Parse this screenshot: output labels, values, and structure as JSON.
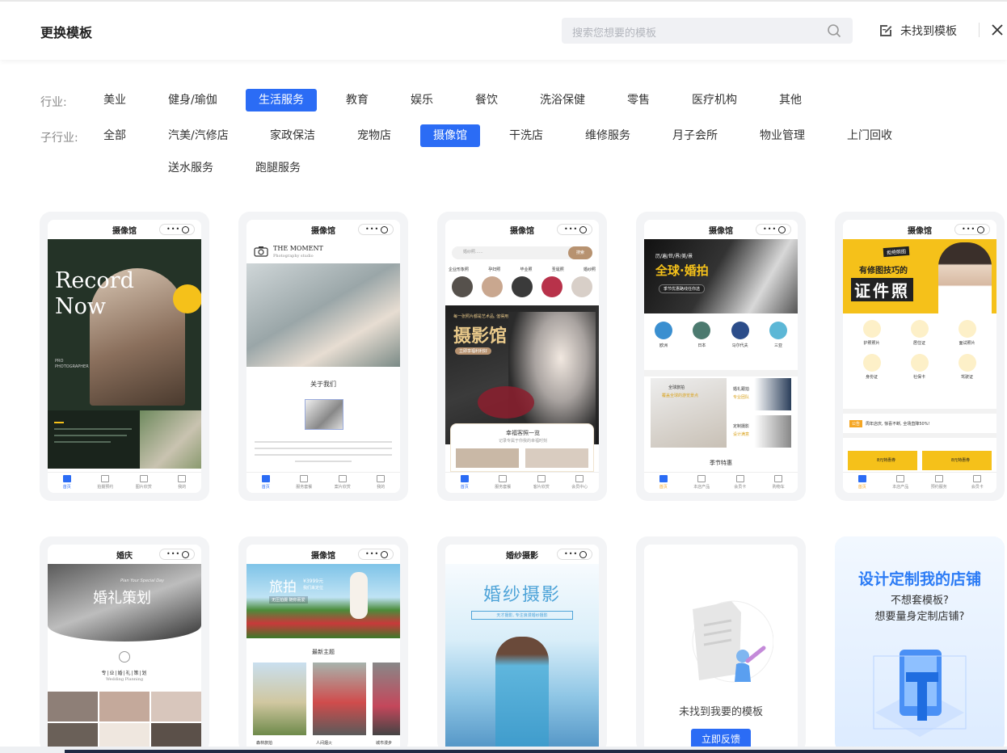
{
  "header": {
    "title": "更换模板",
    "search_placeholder": "搜索您想要的模板",
    "notfound_label": "未找到模板"
  },
  "filters": {
    "industry_label": "行业:",
    "industries": [
      "美业",
      "健身/瑜伽",
      "生活服务",
      "教育",
      "娱乐",
      "餐饮",
      "洗浴保健",
      "零售",
      "医疗机构",
      "其他"
    ],
    "industry_active": "生活服务",
    "subindustry_label": "子行业:",
    "subindustries": [
      "全部",
      "汽美/汽修店",
      "家政保洁",
      "宠物店",
      "摄像馆",
      "干洗店",
      "维修服务",
      "月子会所",
      "物业管理",
      "上门回收",
      "送水服务",
      "跑腿服务"
    ],
    "subindustry_active": "摄像馆"
  },
  "templates": [
    {
      "title": "摄像馆",
      "hero_text": "Record Now",
      "side_text": "PRO PHOTOGRAPHER",
      "tabs": [
        "首页",
        "拍摄预约",
        "图片欣赏",
        "我的"
      ]
    },
    {
      "title": "摄像馆",
      "brand": "THE MOMENT",
      "brand_sub": "Photography studio",
      "section": "关于我们",
      "tabs": [
        "首页",
        "服务套餐",
        "案片欣赏",
        "我的"
      ]
    },
    {
      "title": "摄像馆",
      "search_placeholder": "婚纱照......",
      "search_btn": "搜索",
      "cats": [
        "企业形象照",
        "孕妇照",
        "毕业照",
        "圣诞照",
        "婚纱照"
      ],
      "banner_sub": "每一张照片都是艺术品, 值得用心",
      "banner": "摄影馆",
      "banner_btn": "立即享福利利好",
      "section": "幸福客照一览",
      "section_sub": "记录专属于你我的幸福时刻",
      "tabs": [
        "首页",
        "服务套餐",
        "客片欣赏",
        "会员中心"
      ]
    },
    {
      "title": "摄像馆",
      "banner_small": "历/遍/世/界/美/景",
      "banner": "全球·婚拍",
      "banner_btn": "季节优惠路线任你选",
      "places": [
        "欧洲",
        "日本",
        "马尔代夫",
        "三亚"
      ],
      "promo1_title": "全球旅拍",
      "promo1_sub": "覆盖全球的游览景点",
      "promo2_title": "婚礼跟拍",
      "promo2_sub": "专业团队",
      "promo3_title": "定制摄影",
      "promo3_sub": "设计满意",
      "section": "季节特惠",
      "tabs": [
        "首页",
        "本店产品",
        "会员卡",
        "购物车"
      ]
    },
    {
      "title": "摄像馆",
      "banner_tag": "拒绝照图",
      "banner_mid": "有修图技巧的",
      "banner": "证件照",
      "items": [
        "护照照片",
        "居住证",
        "面试照片",
        "身份证",
        "社保卡",
        "驾驶证"
      ],
      "notice_tag": "公告",
      "notice": "周年店庆, 惊喜不断, 全场直降50%!",
      "coupon": "8元特惠券",
      "tabs": [
        "首页",
        "本店产品",
        "预约服务",
        "会员卡"
      ]
    },
    {
      "title": "婚庆",
      "banner_small": "Plan Your Special Day",
      "banner": "婚礼策划",
      "tagline": "专|业|婚|礼|策|划",
      "tagline_en": "Wedding Planning"
    },
    {
      "title": "摄像馆",
      "banner": "旅拍",
      "banner_price": "¥3999元",
      "banner_sub": "我们来定位",
      "banner_tags": "无压拍摄  随你而爱",
      "section": "最新主题",
      "photos": [
        "森林旅拍",
        "人间烟火",
        "城市漫步"
      ]
    },
    {
      "title": "婚纱摄影",
      "banner": "婚纱摄影",
      "banner_sub": "天才摄影, 专注浪漫婚纱摄影"
    },
    {
      "type": "feedback",
      "text": "未找到我要的模板",
      "button": "立即反馈"
    },
    {
      "type": "custom",
      "title": "设计定制我的店铺",
      "line1": "不想套模板?",
      "line2": "想要量身定制店铺?"
    }
  ],
  "colors": {
    "accent": "#2b6cf5",
    "gold": "#f5c11a",
    "dark_green": "#243327"
  }
}
